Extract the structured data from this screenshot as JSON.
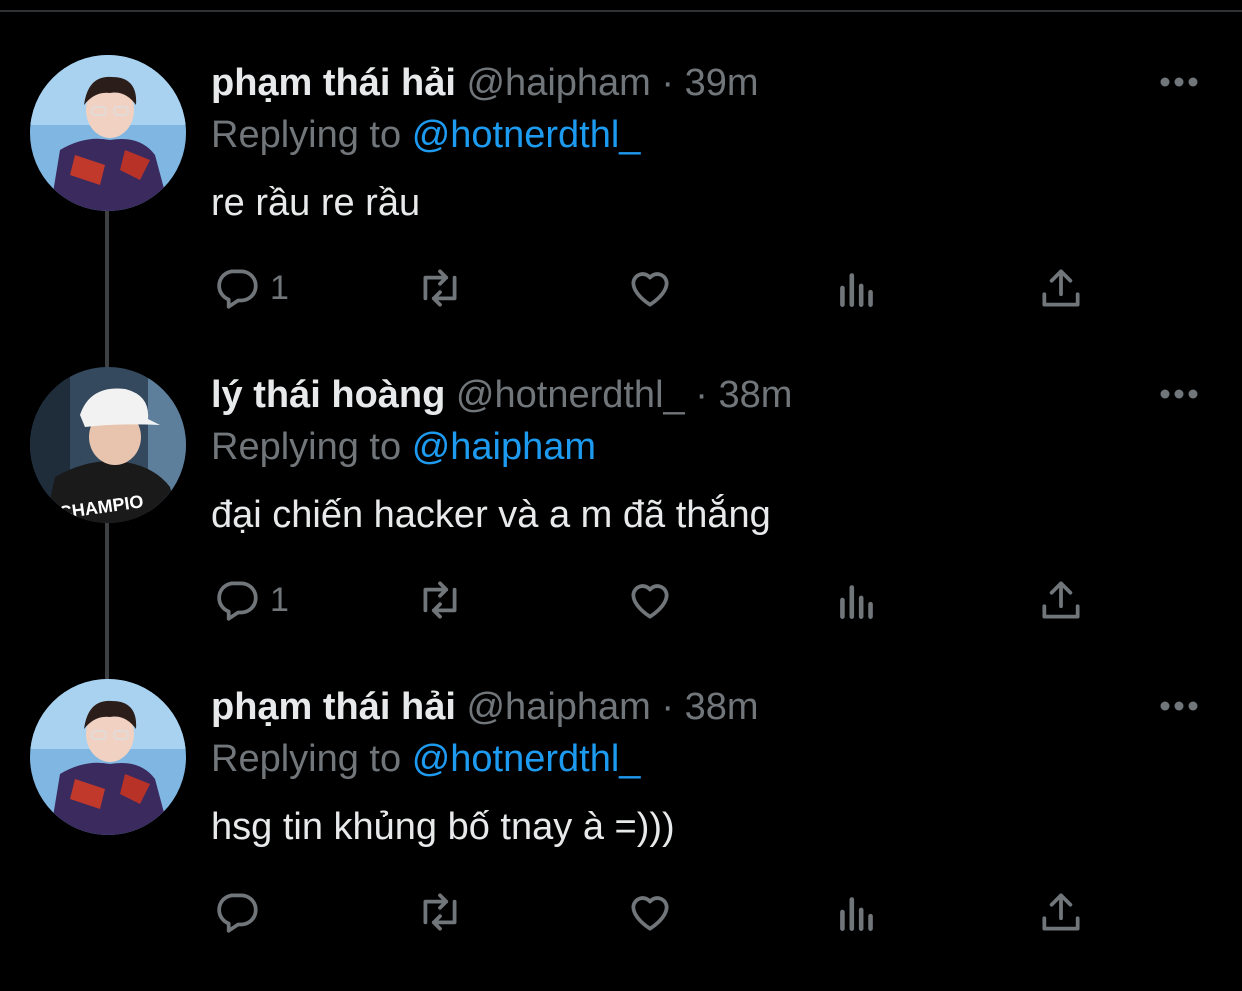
{
  "colors": {
    "background": "#000000",
    "name": "#e7e9ea",
    "secondary": "#71767b",
    "mention": "#1d9bf0",
    "thread_line": "#3e4144"
  },
  "tweets": [
    {
      "name": "phạm thái hải",
      "handle": "@haipham",
      "separator": "·",
      "time": "39m",
      "replying_prefix": "Replying to",
      "replying_to": "@hotnerdthl_",
      "text": "re rầu re rầu",
      "reply_count": "1",
      "avatar_icon": "profile-photo"
    },
    {
      "name": "lý thái hoàng",
      "handle": "@hotnerdthl_",
      "separator": "·",
      "time": "38m",
      "replying_prefix": "Replying to",
      "replying_to": "@haipham",
      "text": "đại chiến hacker và a m đã thắng",
      "reply_count": "1",
      "avatar_icon": "profile-photo",
      "avatar_shirt_text": "CHAMPIO"
    },
    {
      "name": "phạm thái hải",
      "handle": "@haipham",
      "separator": "·",
      "time": "38m",
      "replying_prefix": "Replying to",
      "replying_to": "@hotnerdthl_",
      "text": "hsg tin khủng bố tnay à =)))",
      "reply_count": "",
      "avatar_icon": "profile-photo"
    }
  ],
  "action_icons": [
    "reply-icon",
    "retweet-icon",
    "like-icon",
    "views-icon",
    "share-icon"
  ]
}
